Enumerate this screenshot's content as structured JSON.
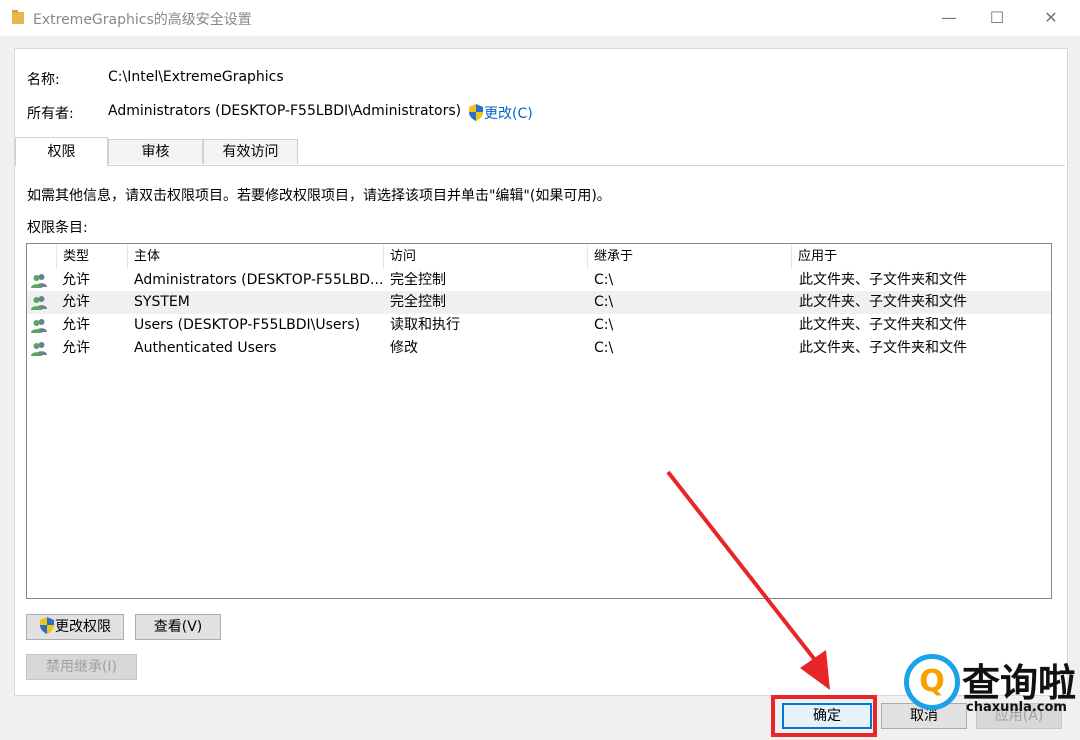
{
  "window": {
    "title": "ExtremeGraphics的高级安全设置",
    "minimize_glyph": "—",
    "maximize_glyph": "☐",
    "close_glyph": "✕"
  },
  "info": {
    "name_label": "名称:",
    "name_value": "C:\\Intel\\ExtremeGraphics",
    "owner_label": "所有者:",
    "owner_value": "Administrators (DESKTOP-F55LBDI\\Administrators)",
    "change_link": "更改(C)"
  },
  "tabs": [
    {
      "label": "权限",
      "active": true
    },
    {
      "label": "审核",
      "active": false
    },
    {
      "label": "有效访问",
      "active": false
    }
  ],
  "instructions": "如需其他信息，请双击权限项目。若要修改权限项目，请选择该项目并单击\"编辑\"(如果可用)。",
  "entries_label": "权限条目:",
  "columns": [
    "类型",
    "主体",
    "访问",
    "继承于",
    "应用于"
  ],
  "rows": [
    {
      "type": "允许",
      "principal": "Administrators (DESKTOP-F55LBD...",
      "access": "完全控制",
      "inherited": "C:\\",
      "applies": "此文件夹、子文件夹和文件",
      "selected": false
    },
    {
      "type": "允许",
      "principal": "SYSTEM",
      "access": "完全控制",
      "inherited": "C:\\",
      "applies": "此文件夹、子文件夹和文件",
      "selected": true
    },
    {
      "type": "允许",
      "principal": "Users (DESKTOP-F55LBDI\\Users)",
      "access": "读取和执行",
      "inherited": "C:\\",
      "applies": "此文件夹、子文件夹和文件",
      "selected": false
    },
    {
      "type": "允许",
      "principal": "Authenticated Users",
      "access": "修改",
      "inherited": "C:\\",
      "applies": "此文件夹、子文件夹和文件",
      "selected": false
    }
  ],
  "buttons": {
    "change_permissions": "更改权限",
    "view": "查看(V)",
    "disable_inheritance": "禁用继承(I)",
    "ok": "确定",
    "cancel": "取消",
    "apply": "应用(A)"
  },
  "watermark": {
    "logo_letter": "Q",
    "name": "查询啦",
    "domain": "chaxunla.com"
  },
  "colors": {
    "accent": "#0078d7",
    "link": "#0066cc",
    "annotation": "#e8262a"
  },
  "icons": [
    "folder-icon",
    "shield-icon",
    "users-icon"
  ]
}
